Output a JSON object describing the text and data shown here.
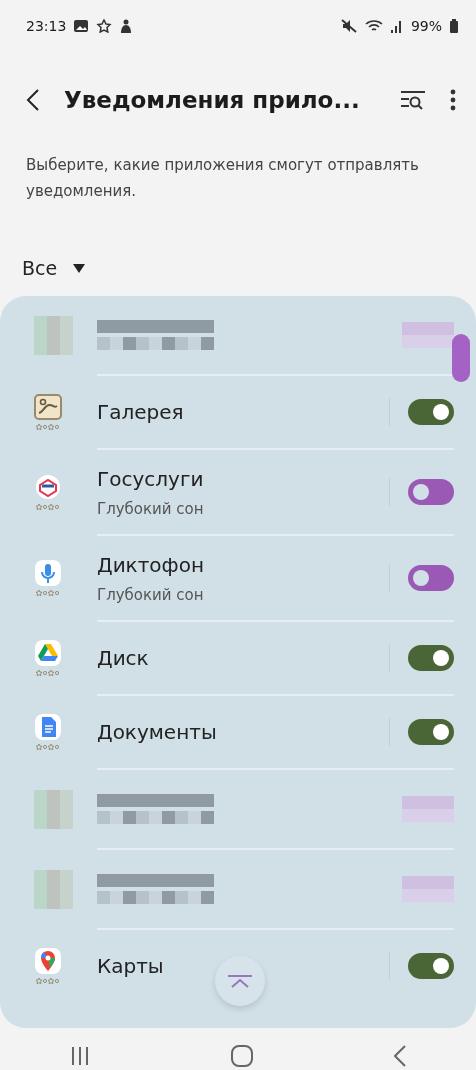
{
  "status_bar": {
    "time": "23:13",
    "battery": "99%"
  },
  "header": {
    "title": "Уведомления прило..."
  },
  "description": "Выберите, какие приложения смогут отправлять уведомления.",
  "filter": {
    "label": "Все"
  },
  "apps": [
    {
      "kind": "redacted"
    },
    {
      "kind": "app",
      "name": "Галерея",
      "on": true
    },
    {
      "kind": "app",
      "name": "Госуслуги",
      "subtitle": "Глубокий сон",
      "on": false
    },
    {
      "kind": "app",
      "name": "Диктофон",
      "subtitle": "Глубокий сон",
      "on": false
    },
    {
      "kind": "app",
      "name": "Диск",
      "on": true
    },
    {
      "kind": "app",
      "name": "Документы",
      "on": true
    },
    {
      "kind": "redacted"
    },
    {
      "kind": "redacted"
    },
    {
      "kind": "app",
      "name": "Карты",
      "on": true
    }
  ]
}
